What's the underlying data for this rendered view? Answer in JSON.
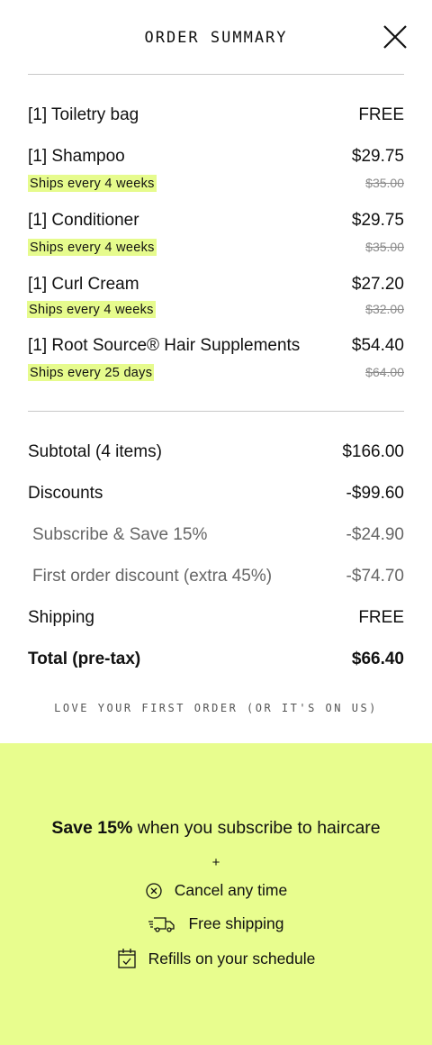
{
  "header": {
    "title": "ORDER SUMMARY",
    "close_label": "close"
  },
  "items": [
    {
      "name": "[1] Toiletry bag",
      "price": "FREE",
      "frequency": "",
      "original_price": ""
    },
    {
      "name": "[1] Shampoo",
      "price": "$29.75",
      "frequency": "Ships every 4 weeks",
      "original_price": "$35.00"
    },
    {
      "name": "[1] Conditioner",
      "price": "$29.75",
      "frequency": "Ships every 4 weeks",
      "original_price": "$35.00"
    },
    {
      "name": "[1] Curl Cream",
      "price": "$27.20",
      "frequency": "Ships every 4 weeks",
      "original_price": "$32.00"
    },
    {
      "name": "[1] Root Source® Hair Supplements",
      "price": "$54.40",
      "frequency": "Ships every 25 days",
      "original_price": "$64.00"
    }
  ],
  "totals": {
    "subtotal_label": "Subtotal (4 items)",
    "subtotal_value": "$166.00",
    "discounts_label": "Discounts",
    "discounts_value": "-$99.60",
    "subscribe_label": "Subscribe & Save 15%",
    "subscribe_value": "-$24.90",
    "first_order_label": "First order discount (extra 45%)",
    "first_order_value": "-$74.70",
    "shipping_label": "Shipping",
    "shipping_value": "FREE",
    "total_label": "Total (pre-tax)",
    "total_value": "$66.40"
  },
  "guarantee": "LOVE YOUR FIRST ORDER (OR IT'S ON US)",
  "promo": {
    "headline_bold": "Save 15%",
    "headline_rest": " when you subscribe to haircare",
    "plus": "+",
    "benefits": [
      {
        "icon": "cancel-icon",
        "label": "Cancel any time"
      },
      {
        "icon": "truck-icon",
        "label": "Free shipping"
      },
      {
        "icon": "calendar-check-icon",
        "label": "Refills on your schedule"
      }
    ]
  },
  "colors": {
    "accent": "#e8fd8e",
    "badge": "#e6fb8d",
    "text": "#111111",
    "muted": "#8a8a8a",
    "divider": "#c8c8c8"
  }
}
